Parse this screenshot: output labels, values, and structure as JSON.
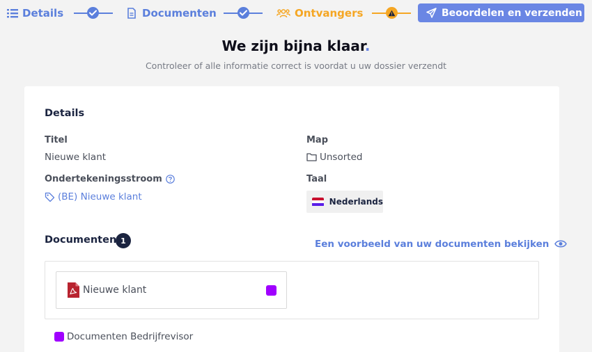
{
  "colors": {
    "step_done": "#5b7fdc",
    "step_warning": "#f5a623",
    "primary_button": "#6a86e4",
    "document_role": "#a000ff"
  },
  "stepper": {
    "steps": [
      {
        "label": "Details",
        "icon": "list-icon",
        "status": "done"
      },
      {
        "label": "Documenten",
        "icon": "document-icon",
        "status": "done"
      },
      {
        "label": "Ontvangers",
        "icon": "users-icon",
        "status": "warning"
      }
    ],
    "send_button": {
      "label": "Beoordelen en verzenden",
      "icon": "paper-plane-icon"
    }
  },
  "page": {
    "title": "We zijn bijna klaar",
    "title_dot": ".",
    "subtitle": "Controleer of alle informatie correct is voordat u uw dossier verzendt"
  },
  "details": {
    "section_title": "Details",
    "title_label": "Titel",
    "title_value": "Nieuwe klant",
    "folder_label": "Map",
    "folder_value": "Unsorted",
    "flow_label": "Ondertekeningsstroom",
    "flow_value": "(BE) Nieuwe klant",
    "language_label": "Taal",
    "language_value": "Nederlands"
  },
  "documents": {
    "section_title": "Documenten",
    "count": "1",
    "preview_link": "Een voorbeeld van uw documenten bekijken",
    "items": [
      {
        "name": "Nieuwe klant",
        "icon": "pdf-icon"
      }
    ],
    "legend": [
      {
        "label": "Documenten Bedrijfrevisor"
      }
    ]
  }
}
